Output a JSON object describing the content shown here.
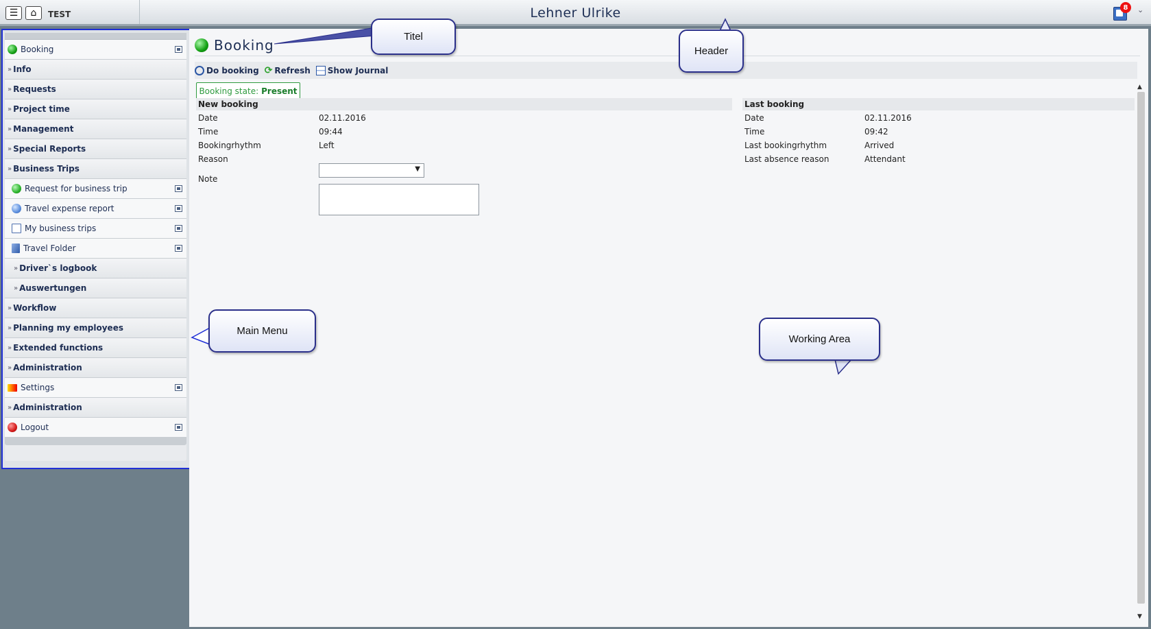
{
  "header": {
    "env_label": "TEST",
    "user_name": "Lehner Ulrike",
    "notification_count": "8",
    "menu_icon": "hamburger-icon",
    "home_icon": "home-icon"
  },
  "menu": {
    "items": [
      {
        "label": "Booking",
        "type": "leaf",
        "icon": "green-ball-icon"
      },
      {
        "label": "Info",
        "type": "group"
      },
      {
        "label": "Requests",
        "type": "group"
      },
      {
        "label": "Project time",
        "type": "group"
      },
      {
        "label": "Management",
        "type": "group"
      },
      {
        "label": "Special Reports",
        "type": "group"
      },
      {
        "label": "Business Trips",
        "type": "group-open"
      },
      {
        "label": "Request for business trip",
        "type": "subleaf",
        "icon": "green-arrow-icon"
      },
      {
        "label": "Travel expense report",
        "type": "subleaf",
        "icon": "blue-arrow-icon"
      },
      {
        "label": "My business trips",
        "type": "subleaf",
        "icon": "list-icon"
      },
      {
        "label": "Travel Folder",
        "type": "subleaf",
        "icon": "folder-icon"
      },
      {
        "label": "Driver`s logbook",
        "type": "subgroup"
      },
      {
        "label": "Auswertungen",
        "type": "subgroup"
      },
      {
        "label": "Workflow",
        "type": "group"
      },
      {
        "label": "Planning my employees",
        "type": "group"
      },
      {
        "label": "Extended functions",
        "type": "group"
      },
      {
        "label": "Administration",
        "type": "group"
      },
      {
        "label": "Settings",
        "type": "leaf",
        "icon": "settings-icon"
      },
      {
        "label": "Administration",
        "type": "group"
      },
      {
        "label": "Logout",
        "type": "leaf",
        "icon": "logout-icon"
      }
    ]
  },
  "page": {
    "title": "Booking",
    "toolbar": {
      "do_booking": "Do booking",
      "refresh": "Refresh",
      "show_journal": "Show Journal"
    },
    "state_label": "Booking state:",
    "state_value": "Present"
  },
  "new_booking": {
    "header": "New booking",
    "date_label": "Date",
    "date_value": "02.11.2016",
    "time_label": "Time",
    "time_value": "09:44",
    "rhythm_label": "Bookingrhythm",
    "rhythm_value": "Left",
    "reason_label": "Reason",
    "reason_value": "",
    "note_label": "Note",
    "note_value": ""
  },
  "last_booking": {
    "header": "Last booking",
    "date_label": "Date",
    "date_value": "02.11.2016",
    "time_label": "Time",
    "time_value": "09:42",
    "rhythm_label": "Last bookingrhythm",
    "rhythm_value": "Arrived",
    "absence_label": "Last absence reason",
    "absence_value": "Attendant"
  },
  "callouts": {
    "titel": "Titel",
    "header": "Header",
    "main_menu": "Main Menu",
    "working_area": "Working Area"
  }
}
